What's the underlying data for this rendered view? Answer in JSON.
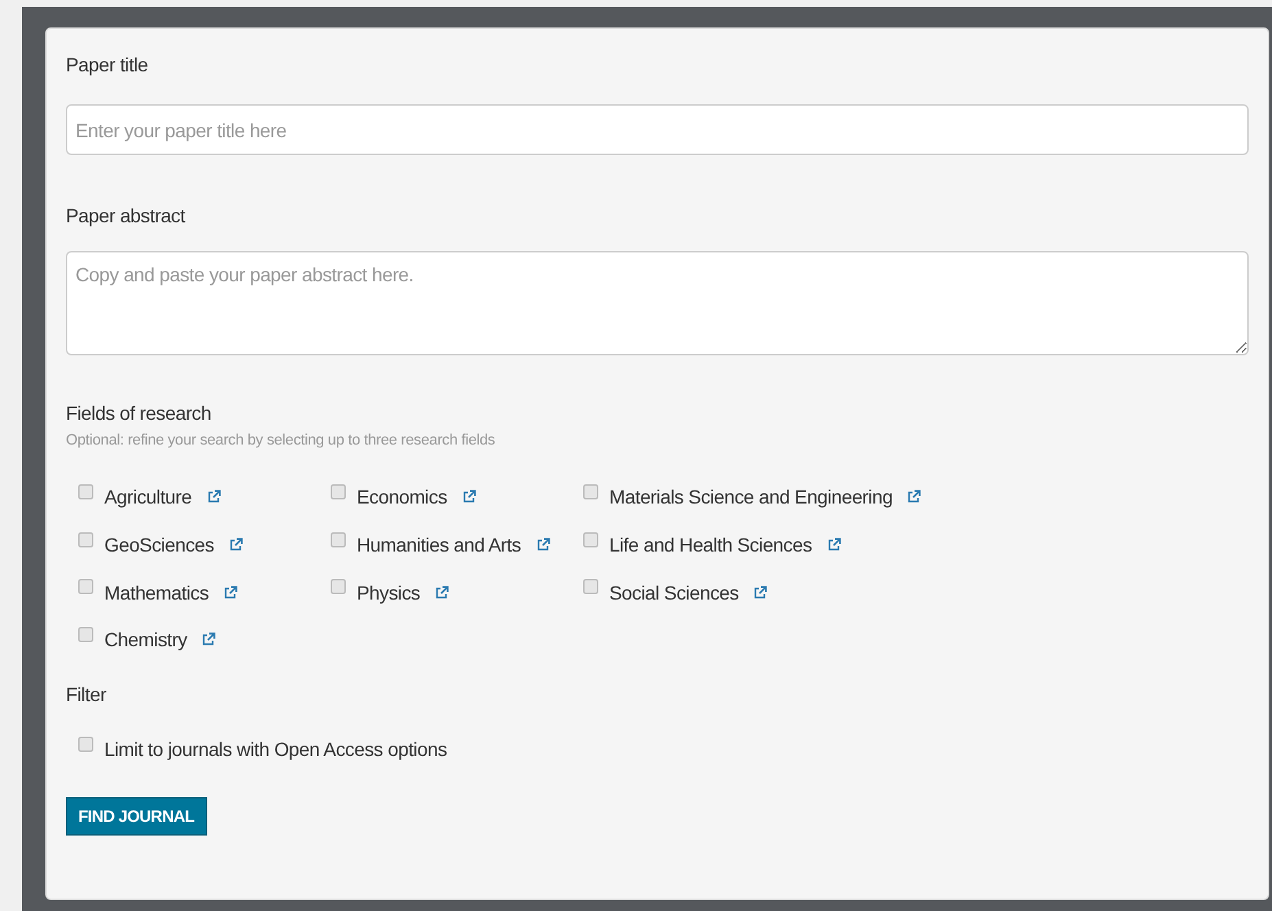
{
  "form": {
    "title_label": "Paper title",
    "title_field": {
      "placeholder": "Enter your paper title here"
    },
    "abstract_label": "Paper abstract",
    "abstract_field": {
      "placeholder": "Copy and paste your paper abstract here."
    },
    "fields_heading": "Fields of research",
    "fields_hint": "Optional: refine your search by selecting up to three research fields",
    "fields": [
      {
        "label": "Agriculture",
        "checked": false
      },
      {
        "label": "GeoSciences",
        "checked": false
      },
      {
        "label": "Mathematics",
        "checked": false
      },
      {
        "label": "Chemistry",
        "checked": false
      },
      {
        "label": "Economics",
        "checked": false
      },
      {
        "label": "Humanities and Arts",
        "checked": false
      },
      {
        "label": "Physics",
        "checked": false
      },
      {
        "label": "Materials Science and Engineering",
        "checked": false
      },
      {
        "label": "Life and Health Sciences",
        "checked": false
      },
      {
        "label": "Social Sciences",
        "checked": false
      }
    ],
    "filter_heading": "Filter",
    "filters": [
      {
        "label": "Limit to journals with Open Access options",
        "checked": false
      }
    ],
    "submit": "FIND JOURNAL"
  }
}
